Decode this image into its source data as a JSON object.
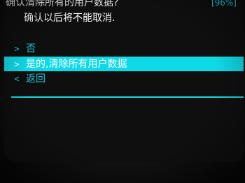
{
  "header": {
    "title": "确认清除所有的用户数据?",
    "battery": "[96%]"
  },
  "subtitle": "确认以后将不能取消.",
  "menu": {
    "items": [
      {
        "marker": ">",
        "label": "否",
        "selected": false
      },
      {
        "marker": ">",
        "label": "是的,清除所有用户数据",
        "selected": true
      },
      {
        "marker": "<",
        "label": "返回",
        "selected": false
      }
    ]
  },
  "colors": {
    "accent": "#10d9e6",
    "text_accent": "#19c7d8",
    "background": "#0f0f0f"
  }
}
